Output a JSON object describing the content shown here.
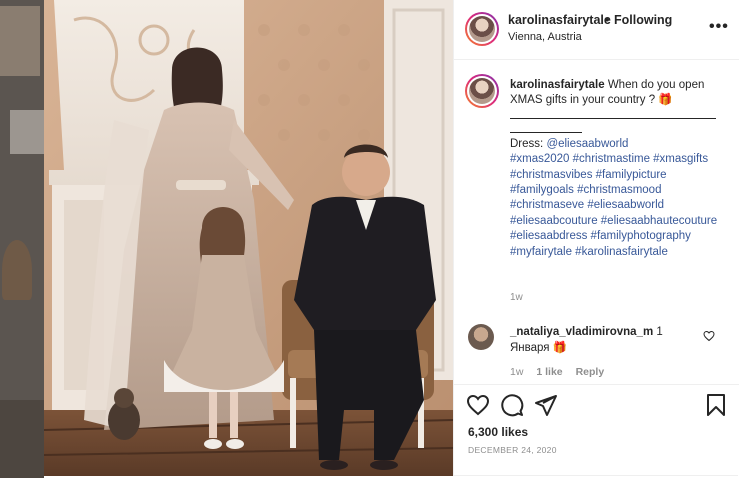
{
  "post": {
    "username": "karolinasfairytale",
    "separator": "•",
    "follow_label": "Following",
    "location": "Vienna, Austria",
    "more_label": "•••"
  },
  "caption": {
    "username": "karolinasfairytale",
    "text": "When do you open XMAS gifts in your country ? 🎁",
    "dress_label": "Dress:",
    "dress_mention": "@eliesaabworld",
    "hashtags": "#xmas2020 #christmastime #xmasgifts #christmasvibes #familypicture #familygoals #christmasmood #christmaseve #eliesaabworld #eliesaabcouture #eliesaabhautecouture #eliesaabdress #familyphotography #myfairytale #karolinasfairytale",
    "time": "1w"
  },
  "comment": {
    "username": "_nataliya_vladimirovna_m",
    "number": "1",
    "text": "Января 🎁",
    "time": "1w",
    "likes": "1 like",
    "reply": "Reply"
  },
  "actions": {
    "likes": "6,300 likes",
    "date": "DECEMBER 24, 2020"
  },
  "icons": {
    "more": "more-options-icon",
    "heart": "heart-icon",
    "comment": "comment-icon",
    "share": "share-icon",
    "save": "bookmark-icon"
  },
  "colors": {
    "hashtag": "#385898",
    "muted": "#8e8e8e",
    "text": "#262626",
    "border": "#efefef"
  }
}
